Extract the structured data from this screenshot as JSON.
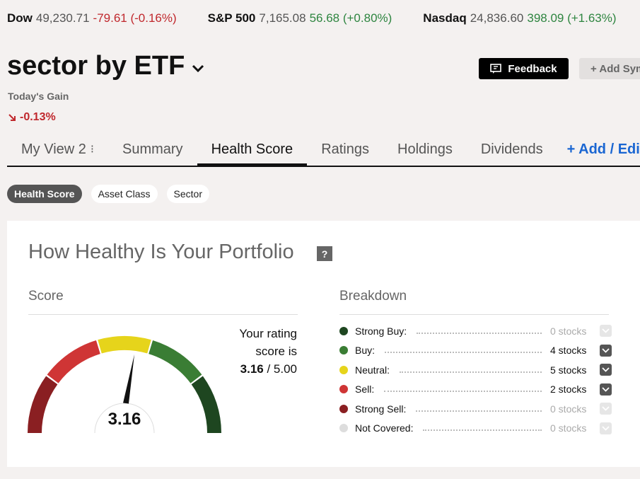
{
  "tickers": [
    {
      "name": "Dow",
      "value": "49,230.71",
      "change": "-79.61 (-0.16%)",
      "dir": "neg"
    },
    {
      "name": "S&P 500",
      "value": "7,165.08",
      "change": "56.68 (+0.80%)",
      "dir": "pos"
    },
    {
      "name": "Nasdaq",
      "value": "24,836.60",
      "change": "398.09 (+1.63%)",
      "dir": "pos"
    }
  ],
  "portfolio": {
    "title": "sector by ETF",
    "gain_label": "Today's Gain",
    "gain_value": "-0.13%"
  },
  "header_buttons": {
    "feedback": "Feedback",
    "add_symbol": "+ Add Symbol"
  },
  "tabs": [
    {
      "label": "My View 2",
      "kebab": "⁝"
    },
    {
      "label": "Summary"
    },
    {
      "label": "Health Score"
    },
    {
      "label": "Ratings"
    },
    {
      "label": "Holdings"
    },
    {
      "label": "Dividends"
    },
    {
      "label": "+ Add / Edit"
    }
  ],
  "active_tab": "Health Score",
  "chips": [
    "Health Score",
    "Asset Class",
    "Sector"
  ],
  "active_chip": "Health Score",
  "card": {
    "title": "How Healthy Is Your Portfolio",
    "help": "?",
    "score_heading": "Score",
    "breakdown_heading": "Breakdown"
  },
  "gauge": {
    "value": 3.16,
    "min": 1,
    "max": 5,
    "display": "3.16"
  },
  "rating": {
    "line1": "Your rating",
    "line2": "score is",
    "score": "3.16",
    "sep": " / ",
    "max": "5.00"
  },
  "colors": {
    "strong_buy": "#1e4620",
    "buy": "#3a7d34",
    "neutral": "#e6d41b",
    "sell": "#cf3535",
    "strong_sell": "#8a1f22",
    "not_covered": "#dddddd",
    "negative": "#c0282d",
    "positive": "#2e8540",
    "link": "#1a66d2"
  },
  "breakdown": [
    {
      "label": "Strong Buy:",
      "count": "0 stocks",
      "color_key": "strong_buy",
      "expandable": false
    },
    {
      "label": "Buy:",
      "count": "4 stocks",
      "color_key": "buy",
      "expandable": true
    },
    {
      "label": "Neutral:",
      "count": "5 stocks",
      "color_key": "neutral",
      "expandable": true
    },
    {
      "label": "Sell:",
      "count": "2 stocks",
      "color_key": "sell",
      "expandable": true
    },
    {
      "label": "Strong Sell:",
      "count": "0 stocks",
      "color_key": "strong_sell",
      "expandable": false
    },
    {
      "label": "Not Covered:",
      "count": "0 stocks",
      "color_key": "not_covered",
      "expandable": false
    }
  ]
}
